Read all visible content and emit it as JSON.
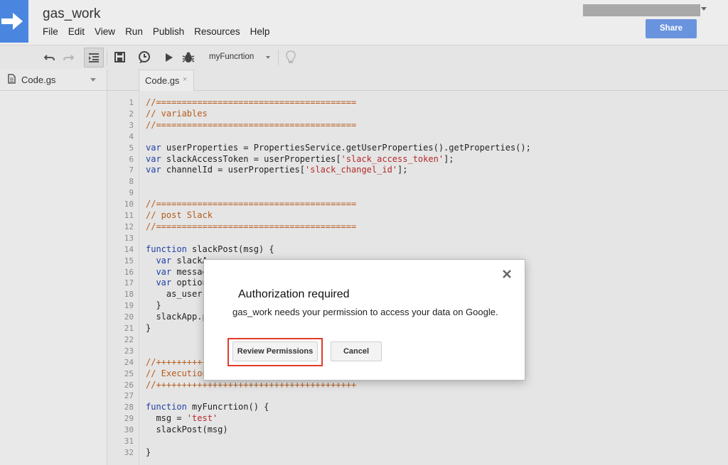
{
  "app": {
    "title": "gas_work",
    "share_label": "Share"
  },
  "menu": [
    "File",
    "Edit",
    "View",
    "Run",
    "Publish",
    "Resources",
    "Help"
  ],
  "toolbar": {
    "selected_function": "myFuncrtion",
    "icons": [
      "undo-icon",
      "redo-icon",
      "indent-icon",
      "save-icon",
      "triggers-icon",
      "run-icon",
      "debug-icon",
      "lightbulb-icon"
    ]
  },
  "sidebar": {
    "files": [
      {
        "name": "Code.gs",
        "icon": "file-icon"
      }
    ]
  },
  "editor": {
    "tab_label": "Code.gs",
    "tab_close": "×",
    "lines": [
      {
        "n": "1",
        "segs": [
          {
            "t": "//=======================================",
            "c": "cm"
          }
        ]
      },
      {
        "n": "2",
        "segs": [
          {
            "t": "// variables",
            "c": "cm"
          }
        ]
      },
      {
        "n": "3",
        "segs": [
          {
            "t": "//=======================================",
            "c": "cm"
          }
        ]
      },
      {
        "n": "4",
        "segs": []
      },
      {
        "n": "5",
        "segs": [
          {
            "t": "var",
            "c": "kw"
          },
          {
            "t": " userProperties = PropertiesService.getUserProperties().getProperties();",
            "c": "pl"
          }
        ]
      },
      {
        "n": "6",
        "segs": [
          {
            "t": "var",
            "c": "kw"
          },
          {
            "t": " slackAccessToken = userProperties[",
            "c": "pl"
          },
          {
            "t": "'slack_access_token'",
            "c": "str"
          },
          {
            "t": "];",
            "c": "pl"
          }
        ]
      },
      {
        "n": "7",
        "segs": [
          {
            "t": "var",
            "c": "kw"
          },
          {
            "t": " channelId = userProperties[",
            "c": "pl"
          },
          {
            "t": "'slack_changel_id'",
            "c": "str"
          },
          {
            "t": "];",
            "c": "pl"
          }
        ]
      },
      {
        "n": "8",
        "segs": []
      },
      {
        "n": "9",
        "segs": []
      },
      {
        "n": "10",
        "segs": [
          {
            "t": "//=======================================",
            "c": "cm"
          }
        ]
      },
      {
        "n": "11",
        "segs": [
          {
            "t": "// post Slack",
            "c": "cm"
          }
        ]
      },
      {
        "n": "12",
        "segs": [
          {
            "t": "//=======================================",
            "c": "cm"
          }
        ]
      },
      {
        "n": "13",
        "segs": []
      },
      {
        "n": "14",
        "segs": [
          {
            "t": "function",
            "c": "kw"
          },
          {
            "t": " slackPost(msg) {",
            "c": "pl"
          }
        ]
      },
      {
        "n": "15",
        "segs": [
          {
            "t": "  var",
            "c": "kw"
          },
          {
            "t": " slackA",
            "c": "pl"
          }
        ]
      },
      {
        "n": "16",
        "segs": [
          {
            "t": "  var",
            "c": "kw"
          },
          {
            "t": " messag",
            "c": "pl"
          }
        ]
      },
      {
        "n": "17",
        "segs": [
          {
            "t": "  var",
            "c": "kw"
          },
          {
            "t": " option",
            "c": "pl"
          }
        ]
      },
      {
        "n": "18",
        "segs": [
          {
            "t": "    as_user",
            "c": "pl"
          }
        ]
      },
      {
        "n": "19",
        "segs": [
          {
            "t": "  }",
            "c": "pl"
          }
        ]
      },
      {
        "n": "20",
        "segs": [
          {
            "t": "  slackApp.p",
            "c": "pl"
          }
        ]
      },
      {
        "n": "21",
        "segs": [
          {
            "t": "}",
            "c": "pl"
          }
        ]
      },
      {
        "n": "22",
        "segs": []
      },
      {
        "n": "23",
        "segs": []
      },
      {
        "n": "24",
        "segs": [
          {
            "t": "//++++++++++",
            "c": "cm"
          }
        ]
      },
      {
        "n": "25",
        "segs": [
          {
            "t": "// Execution",
            "c": "cm"
          }
        ]
      },
      {
        "n": "26",
        "segs": [
          {
            "t": "//+++++++++++++++++++++++++++++++++++++++",
            "c": "cm"
          }
        ]
      },
      {
        "n": "27",
        "segs": []
      },
      {
        "n": "28",
        "segs": [
          {
            "t": "function",
            "c": "kw"
          },
          {
            "t": " myFuncrtion() {",
            "c": "pl"
          }
        ]
      },
      {
        "n": "29",
        "segs": [
          {
            "t": "  msg = ",
            "c": "pl"
          },
          {
            "t": "'test'",
            "c": "str"
          }
        ]
      },
      {
        "n": "30",
        "segs": [
          {
            "t": "  slackPost(msg)",
            "c": "pl"
          }
        ]
      },
      {
        "n": "31",
        "segs": []
      },
      {
        "n": "32",
        "segs": [
          {
            "t": "}",
            "c": "pl"
          }
        ]
      }
    ]
  },
  "dialog": {
    "title": "Authorization required",
    "message": "gas_work needs your permission to access your data on Google.",
    "primary_label": "Review Permissions",
    "secondary_label": "Cancel",
    "close_icon": "close-icon",
    "highlight_color": "#e33b2a"
  },
  "colors": {
    "accent": "#4a86e0",
    "share": "#6a93de",
    "comment": "#b55b1a",
    "keyword": "#2140a6",
    "string": "#b32b2b"
  }
}
